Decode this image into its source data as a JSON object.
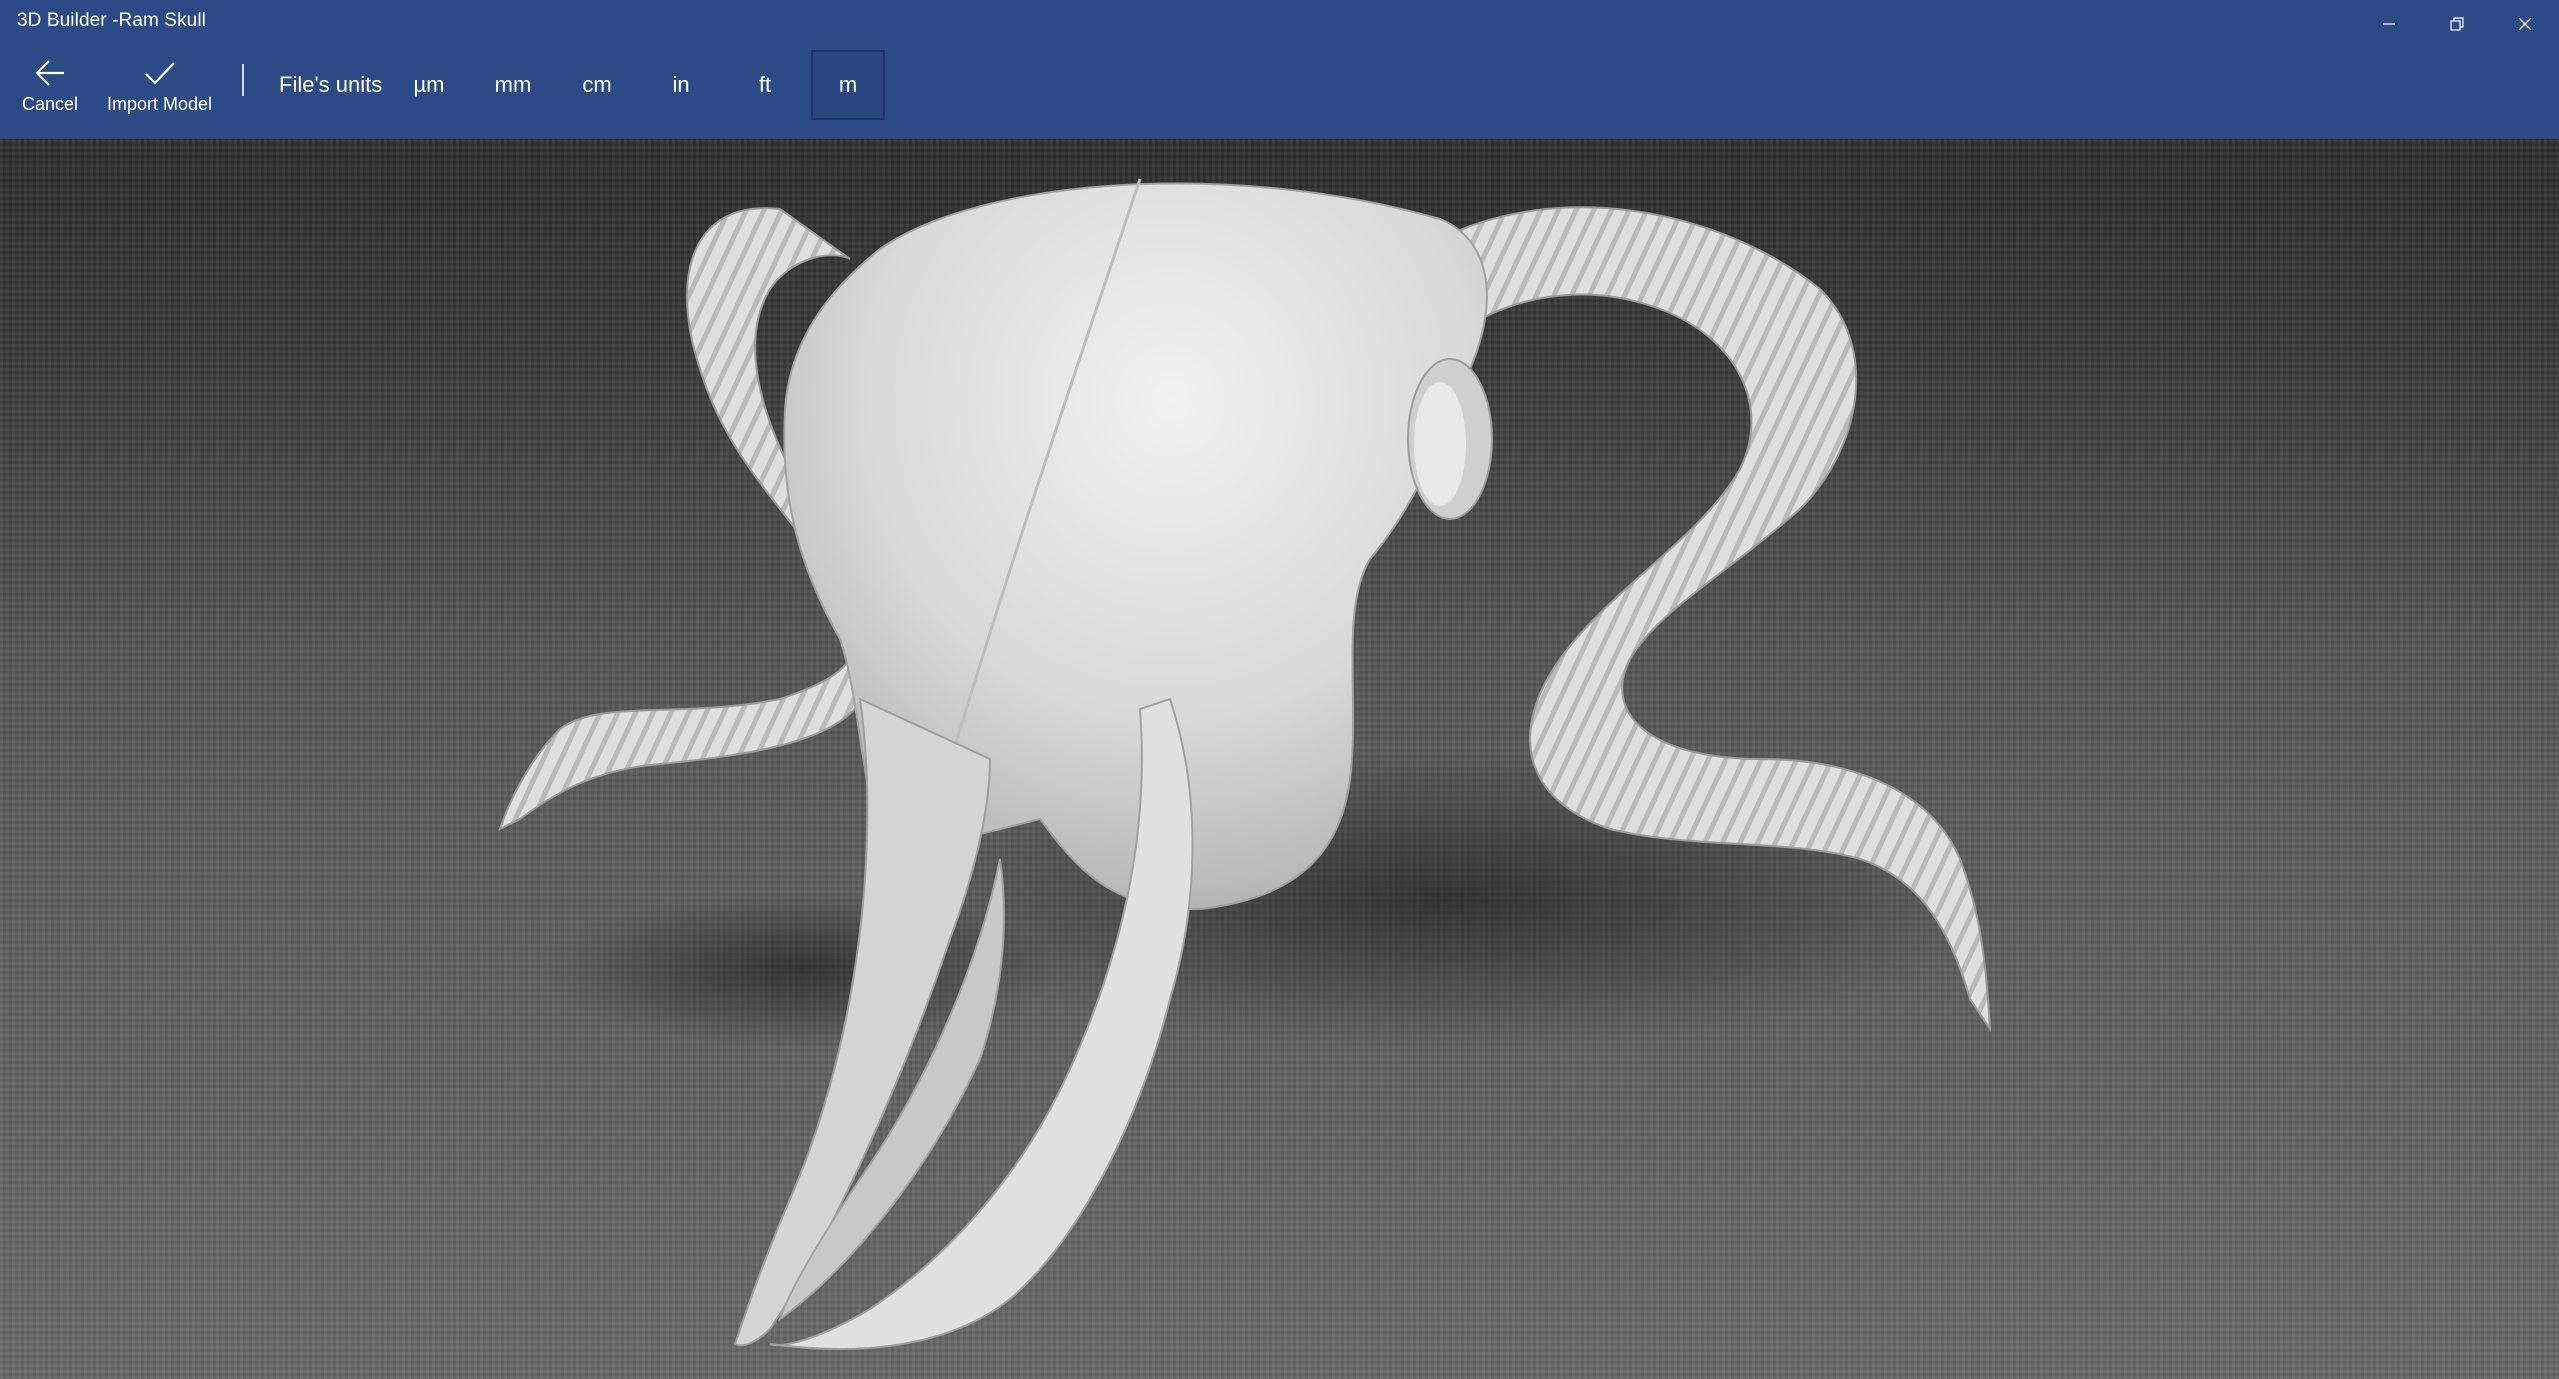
{
  "window": {
    "title": "3D Builder -Ram Skull",
    "controls": [
      "minimize-icon",
      "restore-icon",
      "close-icon"
    ]
  },
  "toolbar": {
    "cancel": {
      "label": "Cancel",
      "icon": "back-arrow-icon"
    },
    "import": {
      "label": "Import Model",
      "icon": "checkmark-icon"
    },
    "units_label": "File's units",
    "units": [
      {
        "label": "µm",
        "selected": false
      },
      {
        "label": "mm",
        "selected": false
      },
      {
        "label": "cm",
        "selected": false
      },
      {
        "label": "in",
        "selected": false
      },
      {
        "label": "ft",
        "selected": false
      },
      {
        "label": "m",
        "selected": true
      }
    ]
  },
  "viewport": {
    "model": "Ram Skull",
    "colors": {
      "accent": "#2c4a85",
      "selected_border": "#1d3564",
      "model": "#d9d9d9"
    }
  }
}
